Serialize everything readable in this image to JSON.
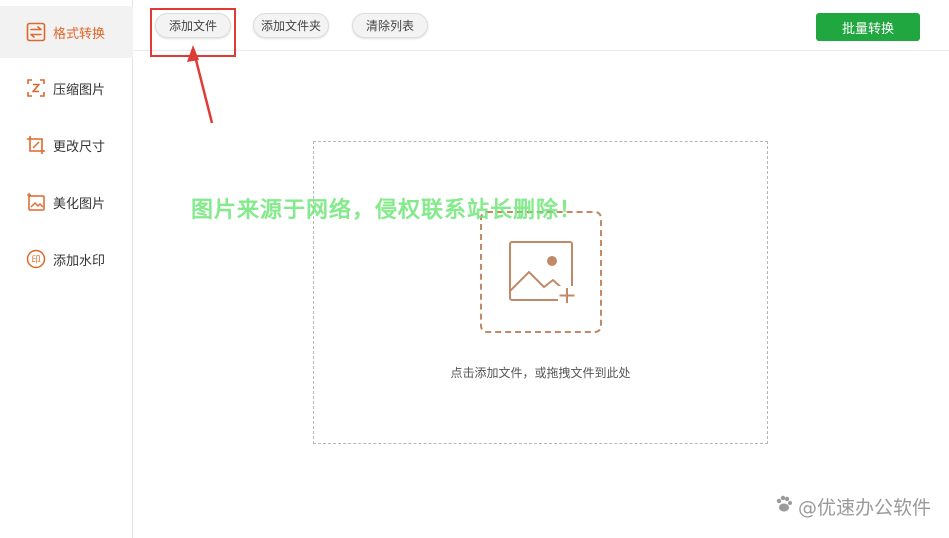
{
  "sidebar": {
    "items": [
      {
        "label": "格式转换",
        "icon": "swap-arrows-icon",
        "active": true
      },
      {
        "label": "压缩图片",
        "icon": "compress-icon",
        "active": false
      },
      {
        "label": "更改尺寸",
        "icon": "resize-crop-icon",
        "active": false
      },
      {
        "label": "美化图片",
        "icon": "beautify-image-icon",
        "active": false
      },
      {
        "label": "添加水印",
        "icon": "stamp-seal-icon",
        "active": false
      }
    ]
  },
  "toolbar": {
    "add_file": "添加文件",
    "add_folder": "添加文件夹",
    "clear_list": "清除列表",
    "batch_convert": "批量转换"
  },
  "dropzone": {
    "hint": "点击添加文件，或拖拽文件到此处",
    "icon": "image-add-icon"
  },
  "overlay": {
    "watermark": "图片来源于网络，侵权联系站长删除！",
    "brand": "@优速办公软件"
  },
  "colors": {
    "accent": "#e0672a",
    "batch_button": "#20a73f",
    "highlight": "#e03a35",
    "drop_icon": "#c08a68",
    "watermark": "#6ee678"
  }
}
